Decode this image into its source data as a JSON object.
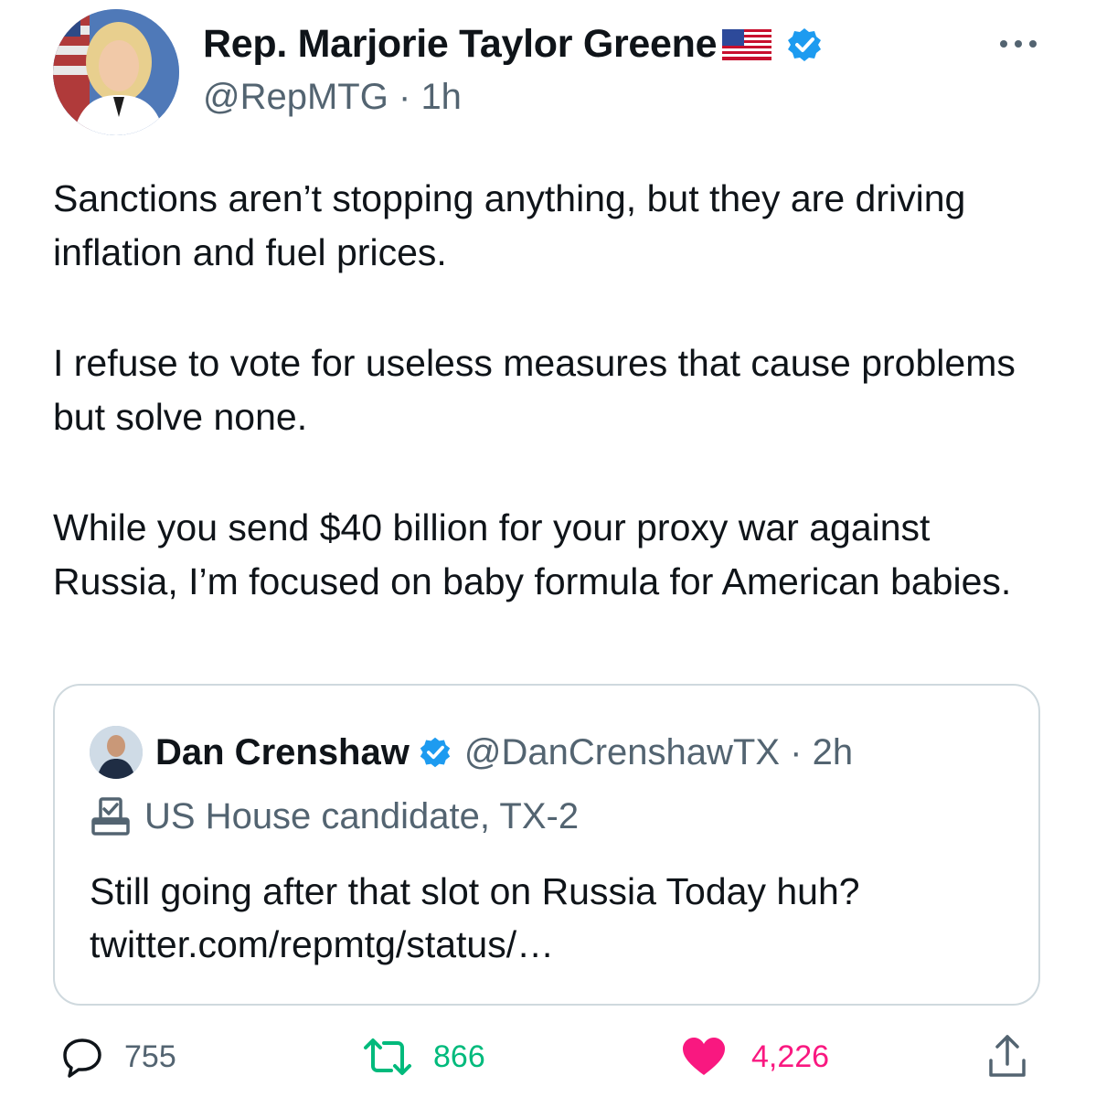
{
  "author": {
    "display_name": "Rep. Marjorie Taylor Greene",
    "handle": "@RepMTG",
    "separator": "·",
    "time": "1h",
    "verified": true,
    "flag": "us-flag-icon"
  },
  "tweet": {
    "paragraphs": [
      "Sanctions aren’t stopping anything, but they are driving inflation and fuel prices.",
      "I refuse to vote for useless measures that cause problems but solve none.",
      "While you send $40 billion for your proxy war against Russia, I’m focused on baby formula for American babies."
    ]
  },
  "quoted": {
    "display_name": "Dan Crenshaw",
    "handle": "@DanCrenshawTX",
    "separator": "·",
    "time": "2h",
    "label": "US House candidate, TX-2",
    "text_line1": "Still going after that slot on Russia Today huh?",
    "text_line2": "twitter.com/repmtg/status/…"
  },
  "actions": {
    "replies": "755",
    "retweets": "866",
    "likes": "4,226"
  },
  "colors": {
    "verified": "#1d9bf0",
    "retweet_active": "#00ba7c",
    "like_active": "#f91880",
    "secondary_text": "#536471"
  }
}
